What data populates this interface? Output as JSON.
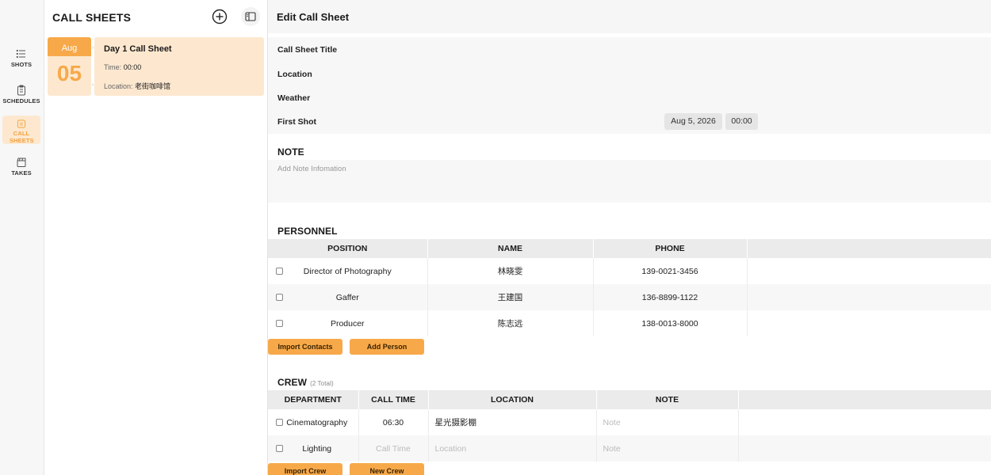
{
  "rail": {
    "items": [
      {
        "label": "SHOTS",
        "icon": "list-icon"
      },
      {
        "label": "SCHEDULES",
        "icon": "clipboard-icon"
      },
      {
        "label": "CALL SHEETS",
        "icon": "call-sheet-icon"
      },
      {
        "label": "TAKES",
        "icon": "clapperboard-icon"
      }
    ],
    "active": "CALL SHEETS"
  },
  "list": {
    "title": "CALL SHEETS",
    "sheets": [
      {
        "month": "Aug",
        "day": "05",
        "title": "Day 1 Call Sheet",
        "time_label": "Time:",
        "time": "00:00",
        "location_label": "Location:",
        "location": "老街咖啡馆"
      }
    ]
  },
  "editor": {
    "title": "Edit Call Sheet",
    "fields": {
      "title_label": "Call Sheet Title",
      "location_label": "Location",
      "weather_label": "Weather",
      "first_shot_label": "First Shot",
      "first_shot_date": "Aug 5, 2026",
      "first_shot_time": "00:00"
    },
    "note": {
      "heading": "NOTE",
      "placeholder": "Add Note Infomation"
    },
    "personnel": {
      "heading": "PERSONNEL",
      "columns": [
        "POSITION",
        "NAME",
        "PHONE"
      ],
      "rows": [
        {
          "position": "Director of Photography",
          "name": "林晓雯",
          "phone": "139-0021-3456"
        },
        {
          "position": "Gaffer",
          "name": "王建国",
          "phone": "136-8899-1122"
        },
        {
          "position": "Producer",
          "name": "陈志远",
          "phone": "138-0013-8000"
        }
      ],
      "import_label": "Import Contacts",
      "add_label": "Add Person"
    },
    "crew": {
      "heading": "CREW",
      "count_text": "(2 Total)",
      "columns": [
        "DEPARTMENT",
        "CALL TIME",
        "LOCATION",
        "NOTE"
      ],
      "rows": [
        {
          "department": "Cinematography",
          "call_time": "06:30",
          "location": "星光摄影棚",
          "note": "Note"
        },
        {
          "department": "Lighting",
          "call_time": "Call Time",
          "location": "Location",
          "note": "Note"
        }
      ],
      "import_label": "Import Crew",
      "new_label": "New Crew"
    }
  },
  "colors": {
    "accent": "#f7a94a",
    "accent_light": "#fde8cf"
  }
}
